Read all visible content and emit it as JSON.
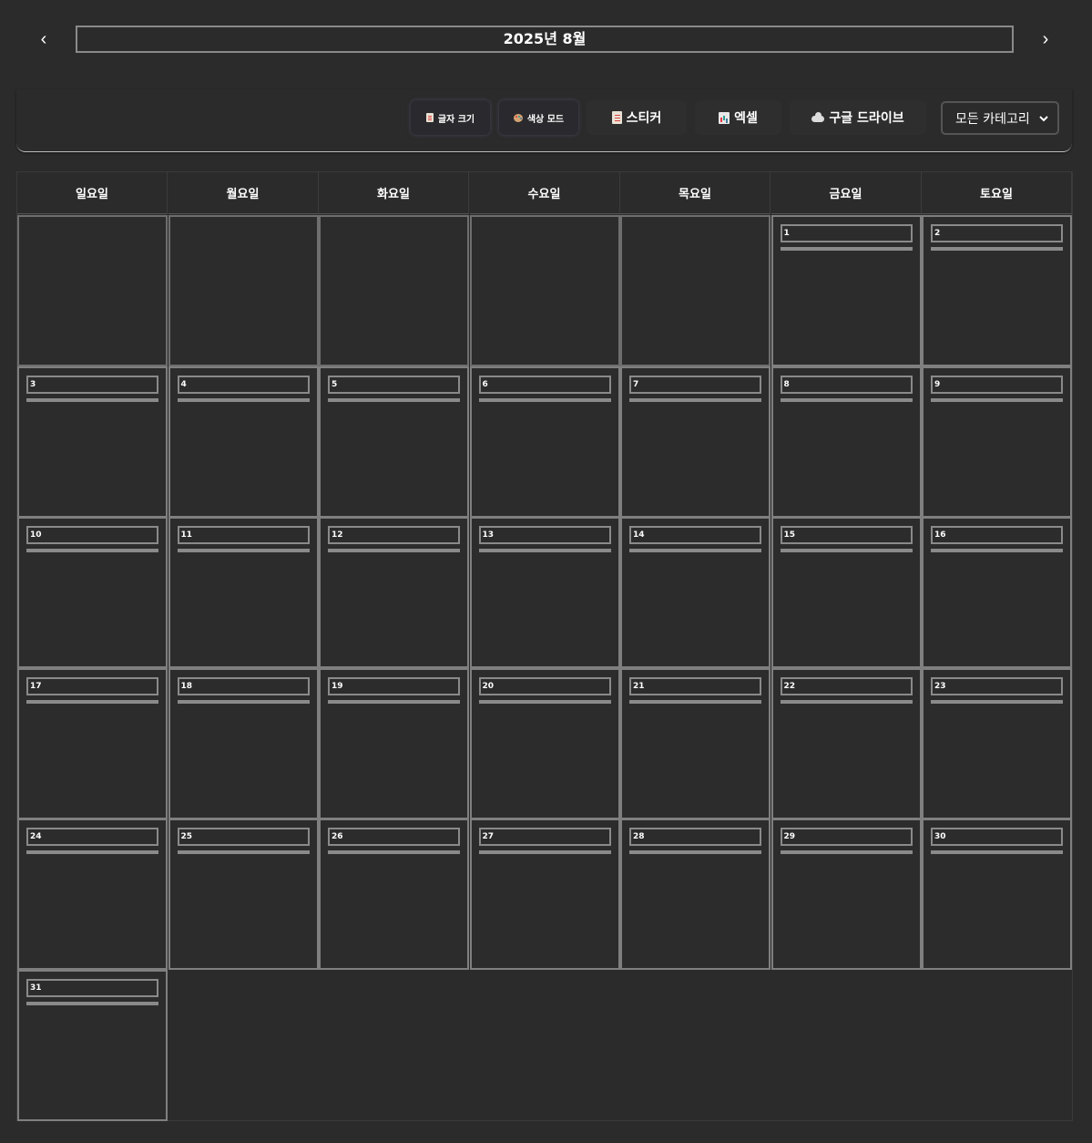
{
  "header": {
    "prev_label": "‹",
    "next_label": "›",
    "month_title": "2025년 8월"
  },
  "toolbar": {
    "font_size_label": "글자 크기",
    "color_mode_label": "색상 모드",
    "sticker_label": "스티커",
    "excel_label": "엑셀",
    "google_drive_label": "구글 드라이브",
    "category_select_value": "모든 카테고리"
  },
  "weekdays": [
    "일요일",
    "월요일",
    "화요일",
    "수요일",
    "목요일",
    "금요일",
    "토요일"
  ],
  "calendar": {
    "year": 2025,
    "month": 8,
    "first_weekday_index": 5,
    "days_in_month": 31
  },
  "days": [
    "1",
    "2",
    "3",
    "4",
    "5",
    "6",
    "7",
    "8",
    "9",
    "10",
    "11",
    "12",
    "13",
    "14",
    "15",
    "16",
    "17",
    "18",
    "19",
    "20",
    "21",
    "22",
    "23",
    "24",
    "25",
    "26",
    "27",
    "28",
    "29",
    "30",
    "31"
  ]
}
